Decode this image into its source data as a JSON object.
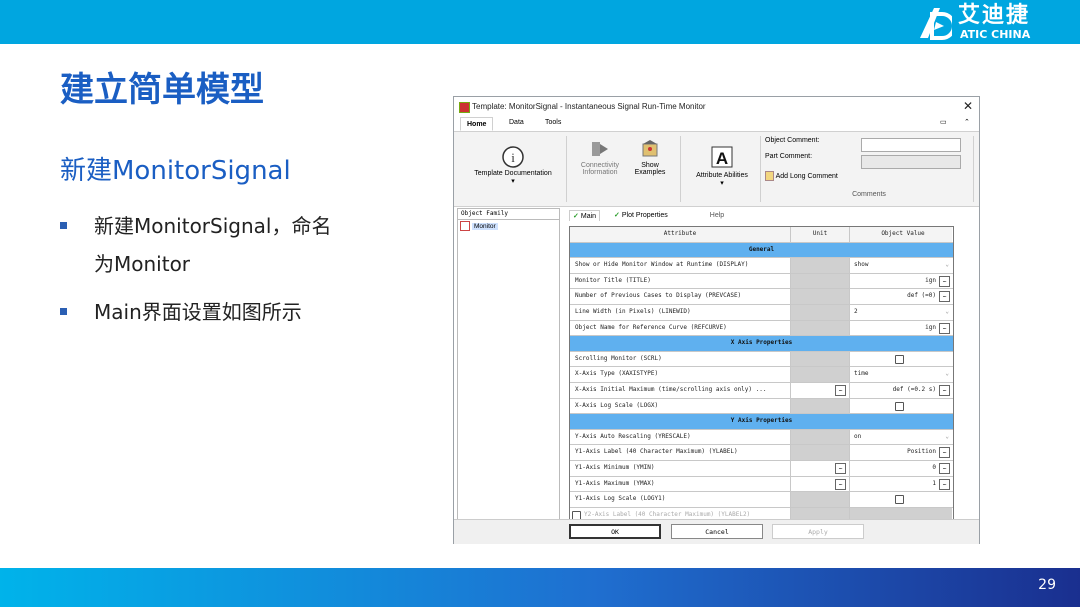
{
  "brand": {
    "name_cn": "艾迪捷",
    "name_en": "ATIC CHINA"
  },
  "slide": {
    "title": "建立简单模型",
    "subtitle": "新建MonitorSignal",
    "bullets": [
      "新建MonitorSignal，命名",
      "为Monitor",
      "Main界面设置如图所示"
    ],
    "page_number": "29"
  },
  "window": {
    "title": "Template: MonitorSignal - Instantaneous Signal Run-Time Monitor",
    "close": "✕",
    "tabs": [
      "Home",
      "Data",
      "Tools"
    ],
    "ribbon": {
      "template_doc": "Template Documentation",
      "connectivity": [
        "Connectivity",
        "Information"
      ],
      "show_examples": [
        "Show",
        "Examples"
      ],
      "attribute_abilities": "Attribute Abilities",
      "help_group": "Help",
      "object_comment": "Object Comment:",
      "part_comment": "Part Comment:",
      "add_long_comment": "Add Long Comment",
      "comments_group": "Comments"
    },
    "object_family": {
      "header": "Object Family",
      "item": "Monitor"
    },
    "subtabs": [
      "Main",
      "Plot Properties"
    ],
    "grid": {
      "headers": [
        "Attribute",
        "Unit",
        "Object Value"
      ],
      "sections": {
        "general": "General",
        "x_axis": "X Axis Properties",
        "y_axis": "Y Axis Properties"
      },
      "rows": {
        "display": {
          "attr": "Show or Hide Monitor Window at Runtime (DISPLAY)",
          "value": "show"
        },
        "title": {
          "attr": "Monitor Title (TITLE)",
          "value": "ign"
        },
        "prevcase": {
          "attr": "Number of Previous Cases to Display (PREVCASE)",
          "value": "def (=0)"
        },
        "linewid": {
          "attr": "Line Width (in Pixels) (LINEWID)",
          "value": "2"
        },
        "refcurve": {
          "attr": "Object Name for Reference Curve (REFCURVE)",
          "value": "ign"
        },
        "scrl": {
          "attr": "Scrolling Monitor (SCRL)"
        },
        "xaxistype": {
          "attr": "X-Axis Type (XAXISTYPE)",
          "value": "time"
        },
        "xmax": {
          "attr": "X-Axis Initial Maximum (time/scrolling axis only) ...",
          "value": "def (=0.2 s)"
        },
        "logx": {
          "attr": "X-Axis Log Scale (LOGX)"
        },
        "yrescale": {
          "attr": "Y-Axis Auto Rescaling (YRESCALE)",
          "value": "on"
        },
        "ylabel": {
          "attr": "Y1-Axis Label (40 Character Maximum) (YLABEL)",
          "value": "Position"
        },
        "ymin": {
          "attr": "Y1-Axis Minimum (YMIN)",
          "value": "0"
        },
        "ymax": {
          "attr": "Y1-Axis Maximum (YMAX)",
          "value": "1"
        },
        "logy1": {
          "attr": "Y1-Axis Log Scale (LOGY1)"
        },
        "ylabel2": {
          "attr": "Y2-Axis Label (40 Character Maximum) (YLABEL2)"
        }
      }
    },
    "buttons": {
      "ok": "OK",
      "cancel": "Cancel",
      "apply": "Apply"
    }
  },
  "colors": {
    "accent": "#00a6e0",
    "title": "#1a5ec3",
    "section": "#5fb0ef"
  }
}
